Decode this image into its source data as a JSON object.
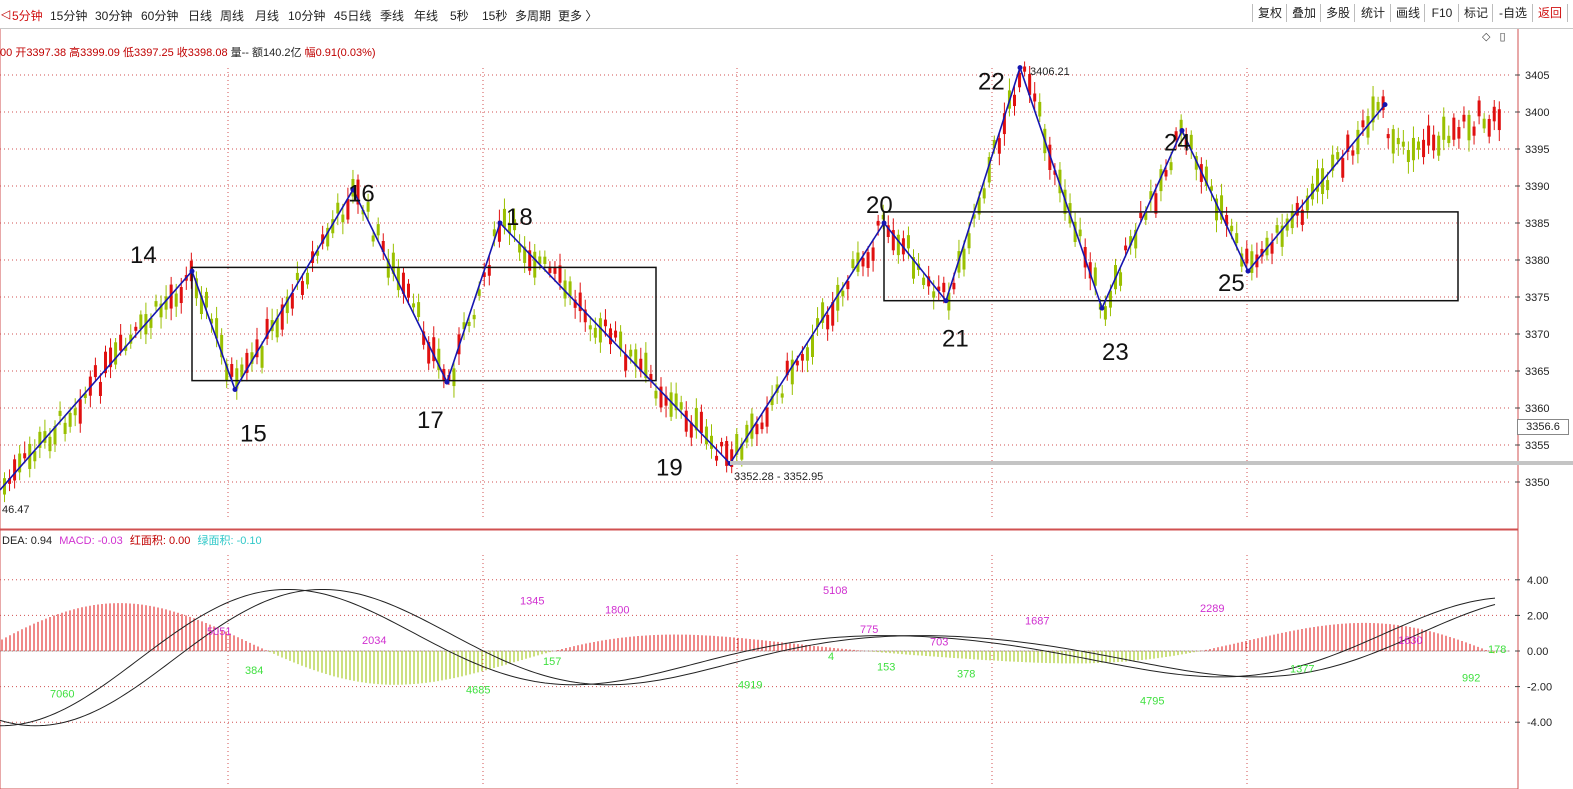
{
  "toolbar": {
    "lead": "◁",
    "timeframes": [
      {
        "label": "5分钟",
        "active": true
      },
      {
        "label": "15分钟",
        "active": false
      },
      {
        "label": "30分钟",
        "active": false
      },
      {
        "label": "60分钟",
        "active": false
      },
      {
        "label": "日线",
        "active": false
      },
      {
        "label": "周线",
        "active": false
      },
      {
        "label": "月线",
        "active": false
      },
      {
        "label": "10分钟",
        "active": false
      },
      {
        "label": "45日线",
        "active": false
      },
      {
        "label": "季线",
        "active": false
      },
      {
        "label": "年线",
        "active": false
      },
      {
        "label": "5秒",
        "active": false
      },
      {
        "label": "15秒",
        "active": false
      },
      {
        "label": "多周期",
        "active": false
      },
      {
        "label": "更多 〉",
        "active": false
      }
    ],
    "buttons": [
      "复权",
      "叠加",
      "多股",
      "统计",
      "画线",
      "F10",
      "标记",
      "-自选",
      "返回"
    ]
  },
  "info": {
    "prefix": "00",
    "open_label": "开",
    "open": "3397.38",
    "high_label": "高",
    "high": "3399.09",
    "low_label": "低",
    "low": "3397.25",
    "close_label": "收",
    "close": "3398.08",
    "vol": "量--",
    "amount_label": "额",
    "amount": "140.2亿",
    "range_label": "幅",
    "range": "0.91(0.03%)"
  },
  "macd_info": {
    "dea_label": "DEA: ",
    "dea": "0.94",
    "macd_label": "MACD: ",
    "macd": "-0.03",
    "red_label": "红面积: ",
    "red": "0.00",
    "green_label": "绿面积: ",
    "green": "-0.10"
  },
  "current_price": "3356.6",
  "colors": {
    "up": "#e01010",
    "down": "#9ac000",
    "wave": "#1515b0",
    "grid": "#d05050",
    "macd_text": "#d030d0",
    "green_text": "#40e040"
  },
  "chart_data": [
    {
      "type": "candlestick",
      "title": "",
      "ylim": [
        3345,
        3408
      ],
      "y_ticks": [
        "3405",
        "3400",
        "3395",
        "3390",
        "3385",
        "3380",
        "3375",
        "3370",
        "3365",
        "3360",
        "3355",
        "3350"
      ],
      "wave_points": [
        {
          "label": "14",
          "price": 3378.5
        },
        {
          "label": "15",
          "price": 3362.5
        },
        {
          "label": "16",
          "price": 3389.5
        },
        {
          "label": "17",
          "price": 3363.5
        },
        {
          "label": "18",
          "price": 3385.0
        },
        {
          "label": "19",
          "price": 3352.5
        },
        {
          "label": "20",
          "price": 3385.0
        },
        {
          "label": "21",
          "price": 3374.5
        },
        {
          "label": "22",
          "price": 3406.0
        },
        {
          "label": "23",
          "price": 3373.5
        },
        {
          "label": "24",
          "price": 3397.5
        },
        {
          "label": "25",
          "price": 3378.5
        }
      ],
      "annotations": [
        "3406.21",
        "3352.28 - 3352.95",
        "46.47"
      ],
      "range_zones": [
        {
          "from_wave": "14",
          "to_wave": "18",
          "top": 3379,
          "bottom": 3363.7
        },
        {
          "from_wave": "20",
          "to_wave": "25",
          "top": 3386.5,
          "bottom": 3374.5
        }
      ]
    },
    {
      "type": "macd",
      "title": "",
      "ylim": [
        -5.5,
        5.5
      ],
      "y_ticks": [
        "4.00",
        "2.00",
        "0.00",
        "-2.00",
        "-4.00"
      ],
      "bar_labels": [
        "7060",
        "5051",
        "384",
        "2034",
        "4685",
        "1345",
        "157",
        "1800",
        "4919",
        "5108",
        "4",
        "775",
        "153",
        "703",
        "378",
        "1687",
        "4795",
        "2289",
        "1377",
        "1630",
        "992",
        "178"
      ]
    }
  ]
}
